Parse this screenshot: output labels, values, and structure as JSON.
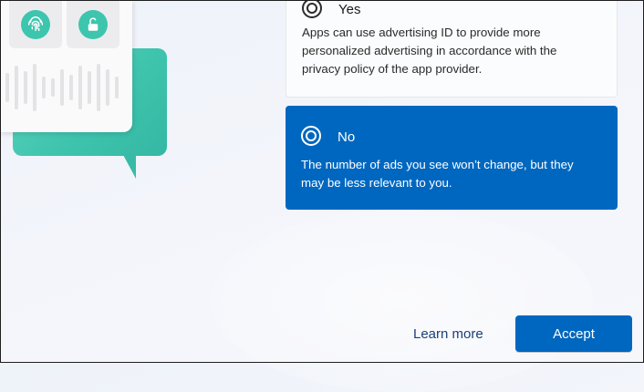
{
  "options": [
    {
      "title": "Yes",
      "description": "Apps can use advertising ID to provide more personalized advertising in accordance with the privacy policy of the app provider.",
      "selected": false
    },
    {
      "title": "No",
      "description": "The number of ads you see won’t change, but they may be less relevant to you.",
      "selected": true
    }
  ],
  "footer": {
    "learn_more_label": "Learn more",
    "accept_label": "Accept"
  },
  "colors": {
    "accent": "#0067c0",
    "illustration_teal": "#3ec5ae",
    "background": "#f2f4f9"
  },
  "illustration": {
    "icons": [
      "fingerprint-icon",
      "unlock-icon"
    ]
  }
}
